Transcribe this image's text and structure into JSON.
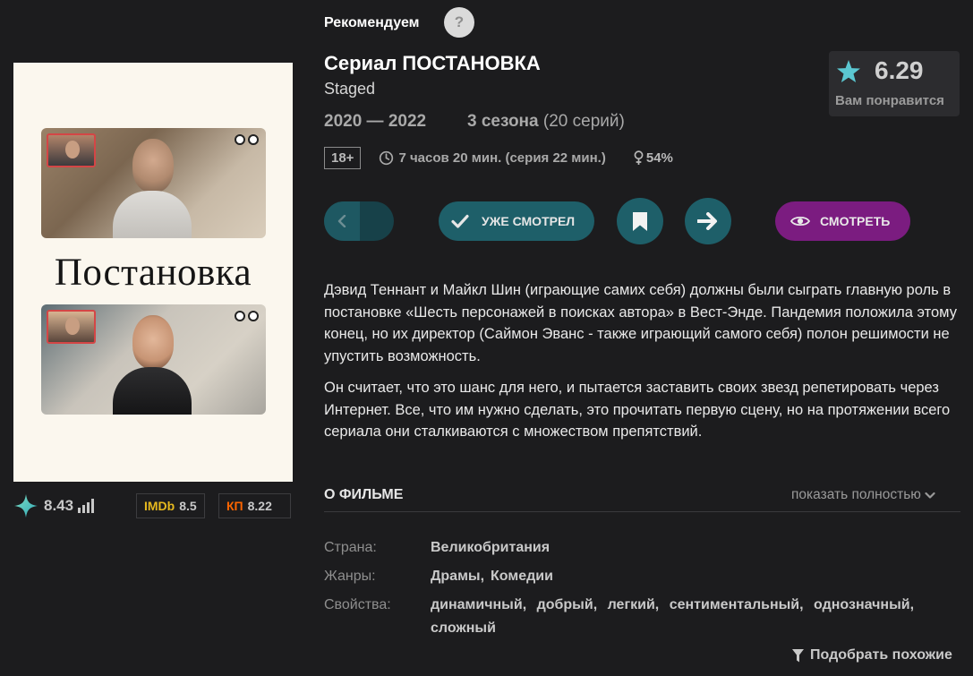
{
  "header": {
    "recommend_label": "Рекомендуем",
    "help_icon": "?",
    "title": "Сериал ПОСТАНОВКА",
    "original_title": "Staged",
    "years": "2020 — 2022",
    "seasons_bold": "3 сезона",
    "seasons_rest": " (20 серий)",
    "age_rating": "18+",
    "duration": "7 часов 20 мин. (серия 22 мин.)",
    "female_audience": "54%"
  },
  "score": {
    "value": "6.29",
    "hint": "Вам понравится",
    "color": "#5bc7d1"
  },
  "poster": {
    "title": "Постановка"
  },
  "ratings": {
    "site": "8.43",
    "imdb_label": "IMDb",
    "imdb": "8.5",
    "kp_label": "КП",
    "kp": "8.22"
  },
  "actions": {
    "watched_label": "УЖЕ СМОТРЕЛ",
    "watch_label": "СМОТРЕТЬ",
    "accent_teal": "#1e5f69",
    "accent_purple": "#7b1c80"
  },
  "description": [
    "Дэвид Теннант и Майкл Шин (играющие самих себя) должны были сыграть главную роль в постановке «Шесть персонажей в поисках автора» в Вест-Энде. Пандемия положила этому конец, но их директор (Саймон Эванс - также играющий самого себя) полон решимости не упустить возможность.",
    "Он считает, что это шанс для него, и пытается заставить своих звезд репетировать через Интернет. Все, что им нужно сделать, это прочитать первую сцену, но на протяжении всего сериала они сталкиваются с множеством препятствий."
  ],
  "about": {
    "heading": "О ФИЛЬМЕ",
    "show_more": "показать полностью",
    "country_label": "Страна:",
    "country": "Великобритания",
    "genres_label": "Жанры:",
    "genres": [
      "Драмы",
      "Комедии"
    ],
    "props_label": "Свойства:",
    "props": [
      "динамичный",
      "добрый",
      "легкий",
      "сентиментальный",
      "однозначный",
      "сложный"
    ],
    "similar": "Подобрать похожие"
  }
}
